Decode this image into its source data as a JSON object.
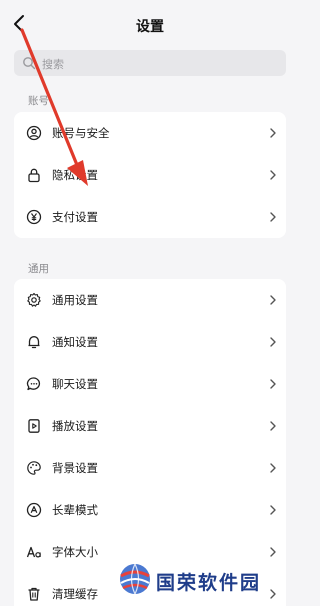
{
  "header": {
    "title": "设置",
    "back_icon": "chevron-left-icon"
  },
  "search": {
    "placeholder": "搜索",
    "icon": "search-icon"
  },
  "sections": {
    "account": {
      "label": "账号",
      "items": [
        {
          "label": "账号与安全",
          "icon": "user-circle-icon"
        },
        {
          "label": "隐私设置",
          "icon": "lock-icon"
        },
        {
          "label": "支付设置",
          "icon": "yen-icon"
        }
      ]
    },
    "general": {
      "label": "通用",
      "items": [
        {
          "label": "通用设置",
          "icon": "gear-icon"
        },
        {
          "label": "通知设置",
          "icon": "bell-icon"
        },
        {
          "label": "聊天设置",
          "icon": "chat-bubble-icon"
        },
        {
          "label": "播放设置",
          "icon": "play-file-icon"
        },
        {
          "label": "背景设置",
          "icon": "palette-icon"
        },
        {
          "label": "长辈模式",
          "icon": "elder-mode-icon"
        },
        {
          "label": "字体大小",
          "icon": "font-size-icon"
        },
        {
          "label": "清理缓存",
          "icon": "trash-icon"
        }
      ]
    }
  },
  "annotation": {
    "arrow_color": "#e03a2b"
  },
  "watermark": {
    "text": "国荣软件园"
  },
  "colors": {
    "background": "#f5f5f7",
    "card": "#ffffff",
    "search_bg": "#e7e7ea",
    "watermark": "#1f3d8a"
  }
}
